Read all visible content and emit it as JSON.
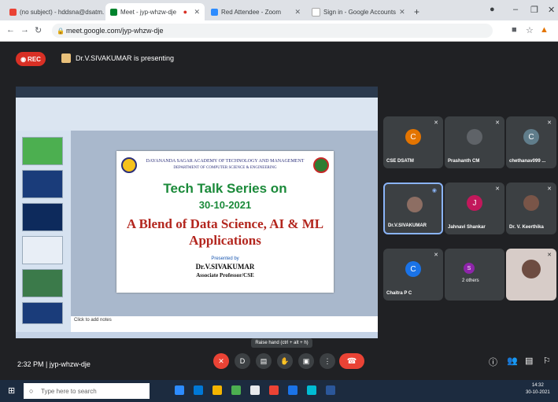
{
  "browser": {
    "tabs": [
      {
        "label": "(no subject) - hddsna@dsatm.edu.in"
      },
      {
        "label": "Meet - jyp-whzw-dje"
      },
      {
        "label": "Red Attendee - Zoom"
      },
      {
        "label": "Sign in - Google Accounts"
      }
    ],
    "new_tab": "+",
    "url": "meet.google.com/jyp-whzw-dje"
  },
  "meet": {
    "rec_label": "REC",
    "presenting_text": "Dr.V.SIVAKUMAR is presenting",
    "meeting_time": "2:32 PM",
    "meeting_code": "jyp-whzw-dje",
    "tooltip": "Raise hand (ctrl + alt + h)",
    "participants": [
      {
        "name": "CSE DSATM",
        "initial": "C",
        "color": "#e37400"
      },
      {
        "name": "Prashanth CM",
        "initial": "",
        "color": "#5f6368"
      },
      {
        "name": "chethanav099 ...",
        "initial": "C",
        "color": "#607d8b"
      },
      {
        "name": "Dr.V.SIVAKUMAR",
        "initial": "",
        "color": "#8d6e63"
      },
      {
        "name": "Jahnavi Shankar",
        "initial": "J",
        "color": "#c2185b"
      },
      {
        "name": "Dr. V. Keerthika",
        "initial": "",
        "color": "#795548"
      },
      {
        "name": "Chaitra P C",
        "initial": "C",
        "color": "#1a73e8"
      },
      {
        "name": "2 others",
        "initial": "S",
        "color": "#8e24aa"
      },
      {
        "name": "",
        "initial": "",
        "color": "#d7ccc8"
      }
    ]
  },
  "slide": {
    "institution": "DAYANANDA SAGAR ACADEMY OF TECHNOLOGY AND MANAGEMENT",
    "department": "DEPARTMENT OF COMPUTER SCIENCE & ENGINEERING",
    "title1": "Tech Talk Series on",
    "date": "30-10-2021",
    "title2": "A Blend of Data Science, AI & ML Applications",
    "presented_by": "Presented by",
    "presenter": "Dr.V.SIVAKUMAR",
    "role": "Associate Professor/CSE",
    "notes_placeholder": "Click to add notes"
  },
  "taskbar": {
    "search_placeholder": "Type here to search",
    "time": "14:32",
    "date": "30-10-2021"
  }
}
